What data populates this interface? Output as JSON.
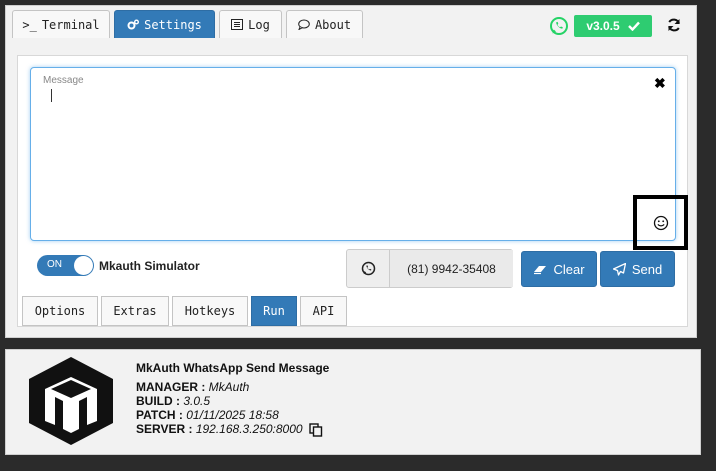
{
  "tabs": [
    {
      "label": "Terminal",
      "icon": ">_"
    },
    {
      "label": "Settings",
      "icon": "gears-icon"
    },
    {
      "label": "Log",
      "icon": "list-icon"
    },
    {
      "label": "About",
      "icon": "comment-icon"
    }
  ],
  "version": {
    "label": "v3.0.5",
    "color": "#2ecc71"
  },
  "message": {
    "label": "Message",
    "value": ""
  },
  "simulator": {
    "toggle_text": "ON",
    "label": "Mkauth Simulator"
  },
  "phone": {
    "number": "(81) 9942-35408"
  },
  "buttons": {
    "clear": "Clear",
    "send": "Send"
  },
  "bottom_tabs": [
    "Options",
    "Extras",
    "Hotkeys",
    "Run",
    "API"
  ],
  "footer": {
    "title": "MkAuth WhatsApp Send Message",
    "manager_label": "MANAGER :",
    "manager": "MkAuth",
    "build_label": "BUILD :",
    "build": "3.0.5",
    "patch_label": "PATCH :",
    "patch": "01/11/2025 18:58",
    "server_label": "SERVER :",
    "server": "192.168.3.250:8000"
  },
  "colors": {
    "accent": "#337ab7",
    "success": "#2ecc71",
    "whatsapp": "#25d366"
  }
}
